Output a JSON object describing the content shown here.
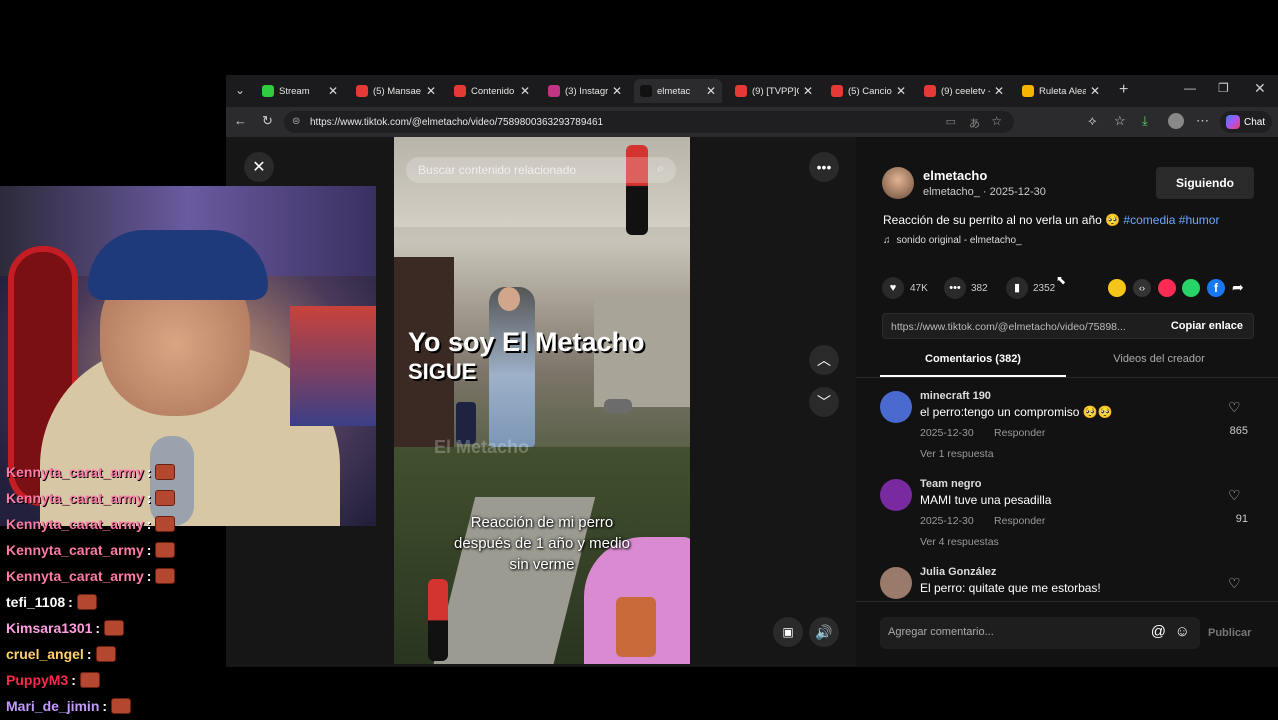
{
  "tabs": [
    {
      "title": "Stream",
      "color": "#2ecc40",
      "active": false
    },
    {
      "title": "(5) Mansae -",
      "color": "#e53935",
      "active": false
    },
    {
      "title": "Contenido d",
      "color": "#e53935",
      "active": false
    },
    {
      "title": "(3) Instagran",
      "color": "#c13584",
      "active": false
    },
    {
      "title": "elmetac",
      "color": "#111111",
      "active": true
    },
    {
      "title": "(9) [TVPP]G",
      "color": "#e53935",
      "active": false
    },
    {
      "title": "(5) Cancione",
      "color": "#e53935",
      "active": false
    },
    {
      "title": "(9) ceeletv -",
      "color": "#e53935",
      "active": false
    },
    {
      "title": "Ruleta Aleat",
      "color": "#f4b400",
      "active": false
    }
  ],
  "address": {
    "url": "https://www.tiktok.com/@elmetacho/video/7589800363293789461",
    "chat_label": "Chat"
  },
  "video": {
    "search_placeholder": "Buscar contenido relacionado",
    "overlay_title": "Yo soy El Metacho",
    "overlay_sub": "SIGUE",
    "caption_line1": "Reacción de mi perro",
    "caption_line2": "después de 1 año y medio",
    "caption_line3": "sin verme",
    "watermark": "El Metacho"
  },
  "author": {
    "name": "elmetacho",
    "handle_date": "elmetacho_ · 2025-12-30",
    "follow_label": "Siguiendo",
    "description": "Reacción de su perrito al no verla un año 🥺",
    "hashtags": "#comedia #humor",
    "sound": "sonido original - elmetacho_"
  },
  "stats": {
    "likes": "47K",
    "comments": "382",
    "saves": "2352"
  },
  "share": {
    "link": "https://www.tiktok.com/@elmetacho/video/75898...",
    "copy_label": "Copiar enlace"
  },
  "tabs_panel": {
    "comments_tab": "Comentarios (382)",
    "videos_tab": "Videos del creador"
  },
  "comments": [
    {
      "user": "minecraft 190",
      "text": "el perro:tengo un compromiso 🥺🥺",
      "date": "2025-12-30",
      "reply": "Responder",
      "likes": "865",
      "replies": "Ver 1 respuesta",
      "avatar": "#4a6ad0"
    },
    {
      "user": "Team negro",
      "text": "MAMI tuve una pesadilla",
      "date": "2025-12-30",
      "reply": "Responder",
      "likes": "91",
      "replies": "Ver 4 respuestas",
      "avatar": "#7a2aa0"
    },
    {
      "user": "Julia González",
      "text": "El perro: quitate que me estorbas!",
      "date": "",
      "reply": "",
      "likes": "",
      "replies": "",
      "avatar": "#9a7a6a"
    }
  ],
  "composer": {
    "placeholder": "Agregar comentario...",
    "publish_label": "Publicar"
  },
  "chat": [
    {
      "user": "Kennyta_carat_army",
      "color": "#ff7aa8"
    },
    {
      "user": "Kennyta_carat_army",
      "color": "#ff7aa8"
    },
    {
      "user": "Kennyta_carat_army",
      "color": "#ff7aa8"
    },
    {
      "user": "Kennyta_carat_army",
      "color": "#ff7aa8"
    },
    {
      "user": "Kennyta_carat_army",
      "color": "#ff7aa8"
    },
    {
      "user": "tefi_1108",
      "color": "#ffffff"
    },
    {
      "user": "Kimsara1301",
      "color": "#ff9de0"
    },
    {
      "user": "cruel_angel",
      "color": "#ffd36b"
    },
    {
      "user": "PuppyM3",
      "color": "#ff2a4a"
    },
    {
      "user": "Mari_de_jimin",
      "color": "#c39bff"
    }
  ]
}
